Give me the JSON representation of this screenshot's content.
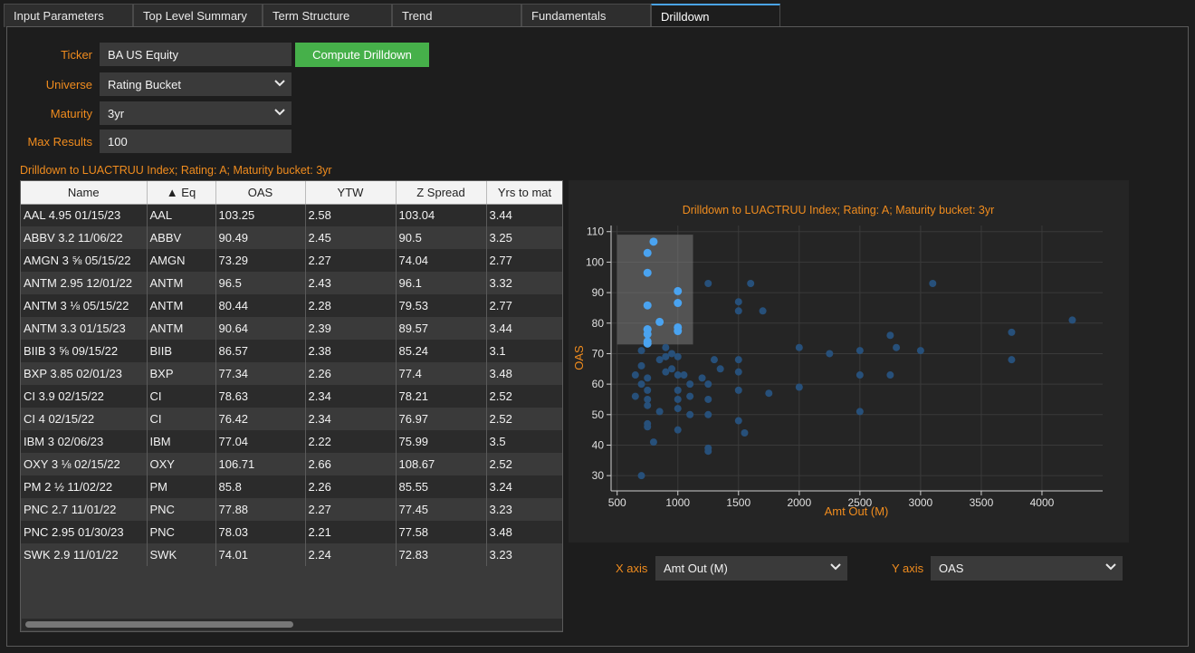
{
  "tabs": [
    "Input Parameters",
    "Top Level Summary",
    "Term Structure",
    "Trend",
    "Fundamentals",
    "Drilldown"
  ],
  "form": {
    "ticker_label": "Ticker",
    "ticker_value": "BA US Equity",
    "universe_label": "Universe",
    "universe_value": "Rating Bucket",
    "maturity_label": "Maturity",
    "maturity_value": "3yr",
    "maxres_label": "Max Results",
    "maxres_value": "100",
    "compute_label": "Compute Drilldown"
  },
  "caption": "Drilldown to LUACTRUU Index; Rating: A; Maturity bucket: 3yr",
  "table": {
    "headers": [
      "Name",
      "▲ Eq",
      "OAS",
      "YTW",
      "Z Spread",
      "Yrs to mat"
    ],
    "rows": [
      [
        "AAL 4.95 01/15/23",
        "AAL",
        "103.25",
        "2.58",
        "103.04",
        "3.44"
      ],
      [
        "ABBV 3.2 11/06/22",
        "ABBV",
        "90.49",
        "2.45",
        "90.5",
        "3.25"
      ],
      [
        "AMGN 3 ⅝ 05/15/22",
        "AMGN",
        "73.29",
        "2.27",
        "74.04",
        "2.77"
      ],
      [
        "ANTM 2.95 12/01/22",
        "ANTM",
        "96.5",
        "2.43",
        "96.1",
        "3.32"
      ],
      [
        "ANTM 3 ⅛ 05/15/22",
        "ANTM",
        "80.44",
        "2.28",
        "79.53",
        "2.77"
      ],
      [
        "ANTM 3.3 01/15/23",
        "ANTM",
        "90.64",
        "2.39",
        "89.57",
        "3.44"
      ],
      [
        "BIIB 3 ⅝ 09/15/22",
        "BIIB",
        "86.57",
        "2.38",
        "85.24",
        "3.1"
      ],
      [
        "BXP 3.85 02/01/23",
        "BXP",
        "77.34",
        "2.26",
        "77.4",
        "3.48"
      ],
      [
        "CI 3.9 02/15/22",
        "CI",
        "78.63",
        "2.34",
        "78.21",
        "2.52"
      ],
      [
        "CI 4 02/15/22",
        "CI",
        "76.42",
        "2.34",
        "76.97",
        "2.52"
      ],
      [
        "IBM 3 02/06/23",
        "IBM",
        "77.04",
        "2.22",
        "75.99",
        "3.5"
      ],
      [
        "OXY 3 ⅛ 02/15/22",
        "OXY",
        "106.71",
        "2.66",
        "108.67",
        "2.52"
      ],
      [
        "PM 2 ½ 11/02/22",
        "PM",
        "85.8",
        "2.26",
        "85.55",
        "3.24"
      ],
      [
        "PNC 2.7 11/01/22",
        "PNC",
        "77.88",
        "2.27",
        "77.45",
        "3.23"
      ],
      [
        "PNC 2.95 01/30/23",
        "PNC",
        "78.03",
        "2.21",
        "77.58",
        "3.48"
      ],
      [
        "SWK 2.9 11/01/22",
        "SWK",
        "74.01",
        "2.24",
        "72.83",
        "3.23"
      ]
    ]
  },
  "chart_data": {
    "type": "scatter",
    "title": "Drilldown to LUACTRUU Index; Rating: A; Maturity bucket: 3yr",
    "xlabel": "Amt Out (M)",
    "ylabel": "OAS",
    "xlim": [
      450,
      4500
    ],
    "ylim": [
      25,
      112
    ],
    "xticks": [
      500,
      1000,
      1500,
      2000,
      2500,
      3000,
      3500,
      4000
    ],
    "yticks": [
      30,
      40,
      50,
      60,
      70,
      80,
      90,
      100,
      110
    ],
    "selection": {
      "x": [
        500,
        1125
      ],
      "y": [
        73,
        109
      ]
    },
    "colors": {
      "selected": "#4aa3f0",
      "unselected": "#27507a",
      "title": "#f08c1e",
      "background": "#252525"
    },
    "selected": [
      [
        750,
        103
      ],
      [
        800,
        106.7
      ],
      [
        750,
        96.5
      ],
      [
        1000,
        90.5
      ],
      [
        1000,
        86.6
      ],
      [
        750,
        85.8
      ],
      [
        850,
        80.4
      ],
      [
        1000,
        78.6
      ],
      [
        1000,
        77.4
      ],
      [
        750,
        77.9
      ],
      [
        750,
        76.4
      ],
      [
        750,
        74.0
      ],
      [
        750,
        73.3
      ],
      [
        750,
        78.0
      ]
    ],
    "unselected": [
      [
        700,
        30
      ],
      [
        650,
        56
      ],
      [
        700,
        60
      ],
      [
        650,
        63
      ],
      [
        700,
        71
      ],
      [
        700,
        66
      ],
      [
        750,
        62
      ],
      [
        750,
        58
      ],
      [
        750,
        55
      ],
      [
        750,
        53
      ],
      [
        750,
        46
      ],
      [
        750,
        47
      ],
      [
        800,
        41
      ],
      [
        850,
        51
      ],
      [
        850,
        68
      ],
      [
        900,
        72
      ],
      [
        900,
        69
      ],
      [
        900,
        64
      ],
      [
        950,
        70
      ],
      [
        950,
        65
      ],
      [
        1000,
        69
      ],
      [
        1000,
        63
      ],
      [
        1000,
        58
      ],
      [
        1000,
        55
      ],
      [
        1000,
        52
      ],
      [
        1000,
        45
      ],
      [
        1050,
        63
      ],
      [
        1100,
        60
      ],
      [
        1100,
        56
      ],
      [
        1100,
        50
      ],
      [
        1200,
        62
      ],
      [
        1250,
        60
      ],
      [
        1250,
        55
      ],
      [
        1250,
        38
      ],
      [
        1250,
        39
      ],
      [
        1250,
        50
      ],
      [
        1250,
        93
      ],
      [
        1300,
        68
      ],
      [
        1350,
        65
      ],
      [
        1500,
        87
      ],
      [
        1500,
        84
      ],
      [
        1500,
        68
      ],
      [
        1500,
        64
      ],
      [
        1500,
        58
      ],
      [
        1500,
        48
      ],
      [
        1550,
        44
      ],
      [
        1600,
        93
      ],
      [
        1700,
        84
      ],
      [
        1750,
        57
      ],
      [
        2000,
        72
      ],
      [
        2000,
        59
      ],
      [
        2250,
        70
      ],
      [
        2500,
        71
      ],
      [
        2500,
        63
      ],
      [
        2500,
        51
      ],
      [
        2750,
        76
      ],
      [
        2750,
        63
      ],
      [
        2800,
        72
      ],
      [
        3000,
        71
      ],
      [
        3100,
        93
      ],
      [
        3750,
        77
      ],
      [
        3750,
        68
      ],
      [
        4250,
        81
      ]
    ]
  },
  "axis_controls": {
    "x_label": "X axis",
    "x_value": "Amt Out (M)",
    "y_label": "Y axis",
    "y_value": "OAS"
  }
}
